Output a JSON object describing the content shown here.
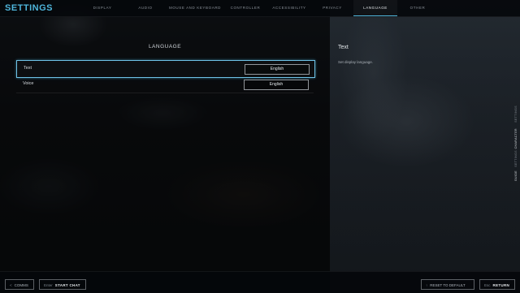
{
  "header": {
    "title": "SETTINGS",
    "tabs": [
      {
        "label": "DISPLAY",
        "active": false
      },
      {
        "label": "AUDIO",
        "active": false
      },
      {
        "label": "MOUSE AND KEYBOARD",
        "active": false
      },
      {
        "label": "CONTROLLER",
        "active": false
      },
      {
        "label": "ACCESSIBILITY",
        "active": false
      },
      {
        "label": "PRIVACY",
        "active": false
      },
      {
        "label": "LANGUAGE",
        "active": true
      },
      {
        "label": "OTHER",
        "active": false
      }
    ]
  },
  "language": {
    "section_title": "LANGUAGE",
    "rows": [
      {
        "label": "Text",
        "value": "English",
        "selected": true
      },
      {
        "label": "Voice",
        "value": "English",
        "selected": false
      }
    ]
  },
  "description": {
    "title": "Text",
    "text": "Set display language."
  },
  "side_labels": [
    "SETTINGS",
    "CHARACTER",
    "SETTINGS",
    "GUIDE"
  ],
  "footer": {
    "combo": {
      "key": "<",
      "label": "COMMS"
    },
    "chat": {
      "key": "Enter",
      "label": "START CHAT"
    },
    "reset": {
      "key": "↑",
      "label": "RESET TO DEFAULT"
    },
    "return": {
      "key": "Esc",
      "label": "RETURN"
    }
  },
  "colors": {
    "accent": "#4fb6dc",
    "selection_border": "#6fc2e6"
  }
}
